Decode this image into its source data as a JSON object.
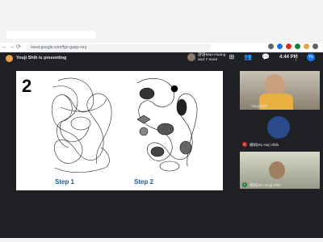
{
  "browser": {
    "url": "meet.google.com/fgn-gasp-nmj"
  },
  "meet": {
    "presenter_text": "Youji Shih is presenting",
    "viewer_name": "游道Mao Huang",
    "viewer_sub": "and 7 more",
    "time": "4:44 PM",
    "user_initial": "Yo",
    "accent": "#1a73e8"
  },
  "slide": {
    "number": "2",
    "step1": "Step 1",
    "step2": "Step 2"
  },
  "participants": [
    {
      "name": "Youji Shih"
    },
    {
      "name": "楊如(Ru Hui) Shih",
      "badge": "L",
      "badge_color": "#d93025"
    },
    {
      "name": "楊如(Zhi Xing) Shih",
      "badge": "Z",
      "badge_color": "#188038"
    }
  ]
}
